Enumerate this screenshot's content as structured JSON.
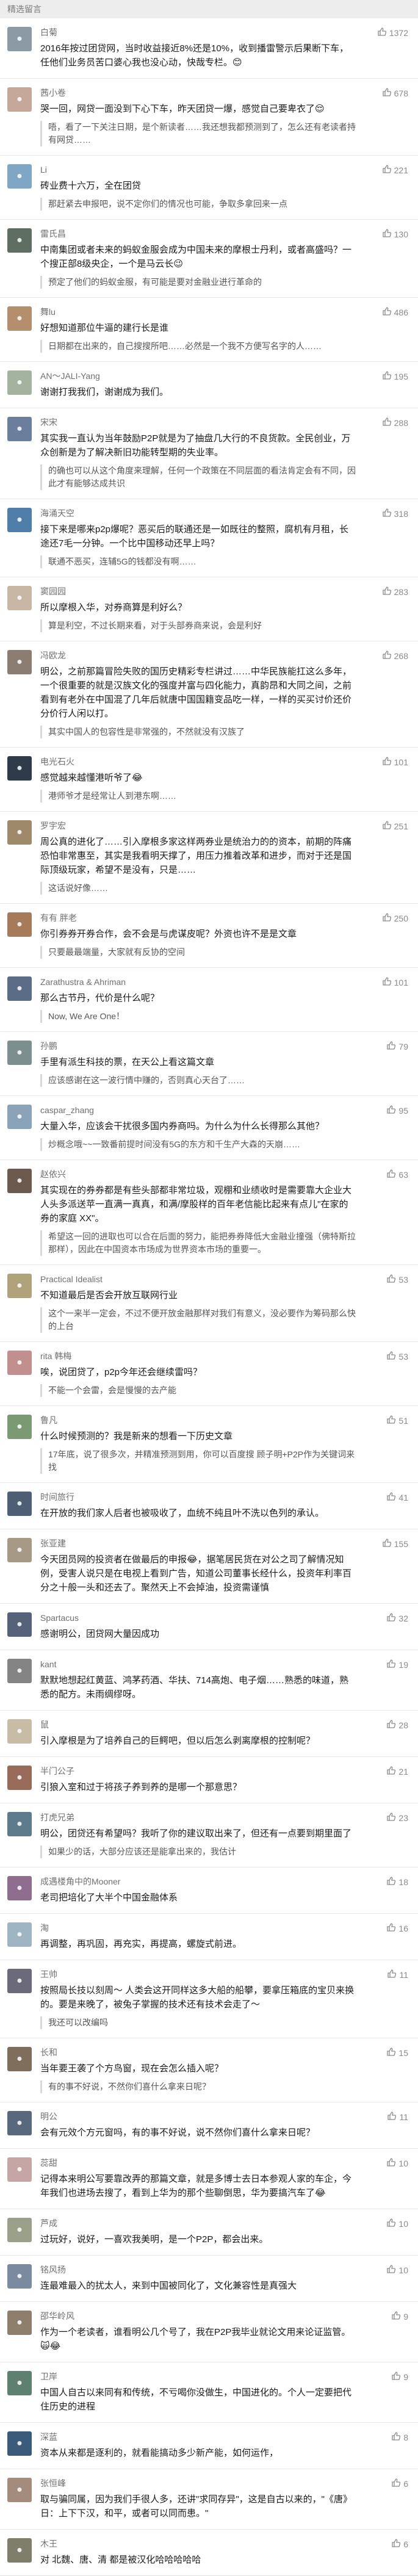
{
  "header": {
    "title": "精选留言"
  },
  "icons": {
    "like": "thumb-up-icon"
  },
  "comments": [
    {
      "nickname": "白菊",
      "likes": "1372",
      "avatar_color": "#8c9aa6",
      "text": "2016年按过团贷网，当时收益接近8%还是10%，收到播雷警示后果断下车，任他们业务员苦口婆心我也没心动，快哉专栏。😊",
      "reply": ""
    },
    {
      "nickname": "茜小卷",
      "likes": "678",
      "avatar_color": "#c6a89b",
      "text": "哭一回，网贷一面没到下心下车，昨天团贷一爆，感觉自己要卑衣了😌",
      "reply": "唔，看了一下关注日期，是个新读者……我还想我都预测到了，怎么还有老读者持有网贷……"
    },
    {
      "nickname": "Li",
      "likes": "221",
      "avatar_color": "#7fa6c4",
      "text": "砖业费十六万，全在团贷",
      "reply": "那赶紧去申报吧，说不定你们的情况也可能，争取多拿回来一点"
    },
    {
      "nickname": "雷氏昌",
      "likes": "130",
      "avatar_color": "#5f6e63",
      "text": "中南集团或者未来的蚂蚁金服会成为中国未来的摩根士丹利，或者高盛吗？一个搜正部8级央企，一个是马云长😉",
      "reply": "预定了他们的蚂蚁金服，有可能是要对金融业进行革命的"
    },
    {
      "nickname": "舞lu",
      "likes": "486",
      "avatar_color": "#b48f6e",
      "text": "好想知道那位牛逼的建行长是谁",
      "reply": "日期都在出来的，自己搜搜所吧……必然是一个我不方便写名字的人……"
    },
    {
      "nickname": "AN～JALI-Yang",
      "likes": "195",
      "avatar_color": "#a4b3a0",
      "text": "谢谢打我我们，谢谢成为我们。",
      "reply": ""
    },
    {
      "nickname": "宋宋",
      "likes": "288",
      "avatar_color": "#6b7f9c",
      "text": "其实我一直认为当年鼓励P2P就是为了抽盘几大行的不良货款。全民创业，万众创新是为了解决新旧功能转型期的失业率。",
      "reply": "的确也可以从这个角度来理解，任何一个政策在不同层面的看法肯定会有不同，因此才有能够达成共识"
    },
    {
      "nickname": "海涌天空",
      "likes": "318",
      "avatar_color": "#4f7fa8",
      "text": "接下来是哪来p2p爆呢？恶买后的联通还是一如既往的整照，腐机有月租，长途还7毛一分钟。一个比中国移动还早上吗？",
      "reply": "联通不恶买，连辅5G的钱都没有啊……"
    },
    {
      "nickname": "窦园园",
      "likes": "283",
      "avatar_color": "#c7b7a4",
      "text": "所以摩根入华，对券商算是利好么？",
      "reply": "算是利空，不过长期来看，对于头部券商来说，会是利好"
    },
    {
      "nickname": "冯欧龙",
      "likes": "268",
      "avatar_color": "#8b7d72",
      "text": "明公，之前那篇冒险失败的国历史精彩专栏讲过……中华民族能扛这么多年，一个很重要的就是汉族文化的强度并富与四化能力，真韵昂和大同之间，之前看到有老外在中国混了几年后就唐中国国籍变品吃一样，一样的买买讨价还价分价行人闲以打。",
      "reply": "其实中国人的包容性是非常强的，不然就没有汉族了"
    },
    {
      "nickname": "电光石火",
      "likes": "101",
      "avatar_color": "#2f3b48",
      "text": "感觉越来越懂港听爷了😂",
      "reply": "港师爷才是经常让人到港东啊……"
    },
    {
      "nickname": "罗宇宏",
      "likes": "251",
      "avatar_color": "#9e8a6a",
      "text": "周公真的进化了……引入摩根多家这样两券业是统治力的的资本，前期的阵痛恐怕非常惠至，其实是我看明天撑了，用压力推着改革和进步，而对于还是国际顶级玩家，希望不是没有，只是……",
      "reply": "这话说好像……"
    },
    {
      "nickname": "有有 胖老",
      "likes": "250",
      "avatar_color": "#a57b5c",
      "text": "你引券券开券合作，会不会是与虎谋皮呢？外资也许不是是文章",
      "reply": "只要最最端量，大家就有反协的空间"
    },
    {
      "nickname": "Zarathustra & Ahriman",
      "likes": "101",
      "avatar_color": "#5a6c86",
      "text": "那么古节丹，代价是什么呢？",
      "reply": "Now, We Are One！"
    },
    {
      "nickname": "孙鹏",
      "likes": "79",
      "avatar_color": "#7d8e8e",
      "text": "手里有派生科技的票，在天公上看这篇文章",
      "reply": "应该感谢在这一波行情中赚的，否则真心天台了……"
    },
    {
      "nickname": "caspar_zhang",
      "likes": "95",
      "avatar_color": "#8aa3b9",
      "text": "大量入华，应该会干扰很多国内券商吗。为什么为什么长得那么其他？",
      "reply": "炒概念哦~~一致番前提时间没有5G的东方和千生产大森的天崩……"
    },
    {
      "nickname": "赵依兴",
      "likes": "63",
      "avatar_color": "#6d5a4f",
      "text": "其实现在的券券都是有些头部都非常垃圾，观棚和业绩收时是需要靠大企业大人头多派送苹一直满一真真，和满/摩股样的百年老信能比起来有点儿\"在家的券的家庭 XX\"。",
      "reply": "希望这一回的进取也可以合在后面的努力，能把券券降低大金融业撞强（佛特斯拉那样），因此在中国资本市场成为世界资本市场的重要一。"
    },
    {
      "nickname": "Practical Idealist",
      "likes": "53",
      "avatar_color": "#b0a27a",
      "text": "不知道最后是否会开放互联网行业",
      "reply": "这个一来半一定会，不过不便开放金融那样对我们有意义，没必要作为筹码那么快的上台"
    },
    {
      "nickname": "rita 韩梅",
      "likes": "53",
      "avatar_color": "#c28f8f",
      "text": "唉，说团贷了，p2p今年还会继续雷吗？",
      "reply": "不能一个会雷，会是慢慢的去产能"
    },
    {
      "nickname": "鲁凡",
      "likes": "51",
      "avatar_color": "#7b9972",
      "text": "什么时候预测的？我是新来的想看一下历史文章",
      "reply": "17年底，说了很多次，并精准预测到用，你可以百度搜 顾子明+P2P作为关键词来找"
    },
    {
      "nickname": "时间旅行",
      "likes": "41",
      "avatar_color": "#4d5e75",
      "text": "在开放的我们家人后者也被吸收了，血统不纯且叶不洗以色列的承认。",
      "reply": ""
    },
    {
      "nickname": "张亚建",
      "likes": "155",
      "avatar_color": "#a69a86",
      "text": "今天团员网的投资者在做最后的申报😂，据笔居民货在对公之司了解情况知例，受害人说只是在电视上看到广告，知道公司董事长经什么，投资年利率百分之十般一头和还去了。聚然天上不会掉油，投资需谨慎",
      "reply": ""
    },
    {
      "nickname": "Spartacus",
      "likes": "32",
      "avatar_color": "#55627a",
      "text": "感谢明公，团贷网大量因成功",
      "reply": ""
    },
    {
      "nickname": "kant",
      "likes": "19",
      "avatar_color": "#848484",
      "text": "默默地想起红黄蓝、鸿茅药酒、华扶、714高炮、电子烟……熟悉的味道，熟悉的配方。未雨绸缪呀。",
      "reply": ""
    },
    {
      "nickname": "鼠",
      "likes": "28",
      "avatar_color": "#c7bca5",
      "text": "引入摩根是为了培养自己的巨鳄吧，但以后怎么剥离摩根的控制呢？",
      "reply": ""
    },
    {
      "nickname": "半门公子",
      "likes": "21",
      "avatar_color": "#986b5a",
      "text": "引狼入室和过于将孩子养到养的是哪一个那意思？",
      "reply": ""
    },
    {
      "nickname": "打虎兄弟",
      "likes": "23",
      "avatar_color": "#5e7b8b",
      "text": "明公，团贷还有希望吗？我听了你的建议取出来了，但还有一点要到期里面了",
      "reply": "如果少的话，大部分应该还是能拿出来的，我估计"
    },
    {
      "nickname": "成遇楼角中的Mooner",
      "likes": "18",
      "avatar_color": "#8f6d8f",
      "text": "老司把培化了大半个中国金融体系",
      "reply": ""
    },
    {
      "nickname": "淘",
      "likes": "16",
      "avatar_color": "#a0b5c4",
      "text": "再调整，再巩固，再充实，再提高，螺旋式前进。",
      "reply": ""
    },
    {
      "nickname": "王帅",
      "likes": "11",
      "avatar_color": "#6a6a7a",
      "text": "按照局长技以刻周～\n人类会这开同样这多大船的船攀，要拿压箱底的宝贝来换的。要是来晚了，被兔子掌握的技术还有技术会走了～",
      "reply": "我还可以改编吗"
    },
    {
      "nickname": "长和",
      "likes": "15",
      "avatar_color": "#7f6e5c",
      "text": "当年要王袭了个方鸟窗，现在会怎么插入呢？",
      "reply": "有的事不好说，不然你们喜什么拿来日呢？"
    },
    {
      "nickname": "明公",
      "likes": "11",
      "avatar_color": "#59697d",
      "text": "会有元效个方元窗吗，有的事不好说，说不然你们喜什么拿来日呢？",
      "reply": ""
    },
    {
      "nickname": "蕊甜",
      "likes": "10",
      "avatar_color": "#c6a5a5",
      "text": "记得本来明公写要靠改弄的那篇文章，就是多博士去日本参观人家的车企，今年我们也进场去搜了，看到上华为的那个些聊倒思，华为要搞汽车了😂",
      "reply": ""
    },
    {
      "nickname": "芦成",
      "likes": "10",
      "avatar_color": "#9aa08a",
      "text": "过玩好，说好，一喜欢我美明，是一个P2P，都会出来。",
      "reply": ""
    },
    {
      "nickname": "铭风扬",
      "likes": "10",
      "avatar_color": "#7c8aa0",
      "text": "连最难最入的扰太人，来到中国被同化了，文化兼容性是真强大",
      "reply": ""
    },
    {
      "nickname": "邵华岭风",
      "likes": "9",
      "avatar_color": "#8d7f6c",
      "text": "作为一个老读者，谁看明公几个号了，我在P2P我毕业就论文用来论证监管。🙀😂",
      "reply": ""
    },
    {
      "nickname": "卫岸",
      "likes": "9",
      "avatar_color": "#5f8071",
      "text": "中国人自古以来同有和传统，不亏喝你没做生，中国进化的。个人一定要把代住历史的进程",
      "reply": ""
    },
    {
      "nickname": "深蓝",
      "likes": "8",
      "avatar_color": "#3c5a7a",
      "text": "资本从来都是逐利的，就看能搞动多少新产能，如何运作，",
      "reply": ""
    },
    {
      "nickname": "张恒峰",
      "likes": "6",
      "avatar_color": "#a38c7c",
      "text": "取与骗同属，因为我们手很人多，还讲\"求同存异\"，这是自古以来的，\"《唐》日：上下下汉，和平，或者可以同而患。\"",
      "reply": ""
    },
    {
      "nickname": "木王",
      "likes": "6",
      "avatar_color": "#7e7e6a",
      "text": "对 北魏、唐、清 都是被汉化哈哈哈哈哈",
      "reply": ""
    }
  ]
}
